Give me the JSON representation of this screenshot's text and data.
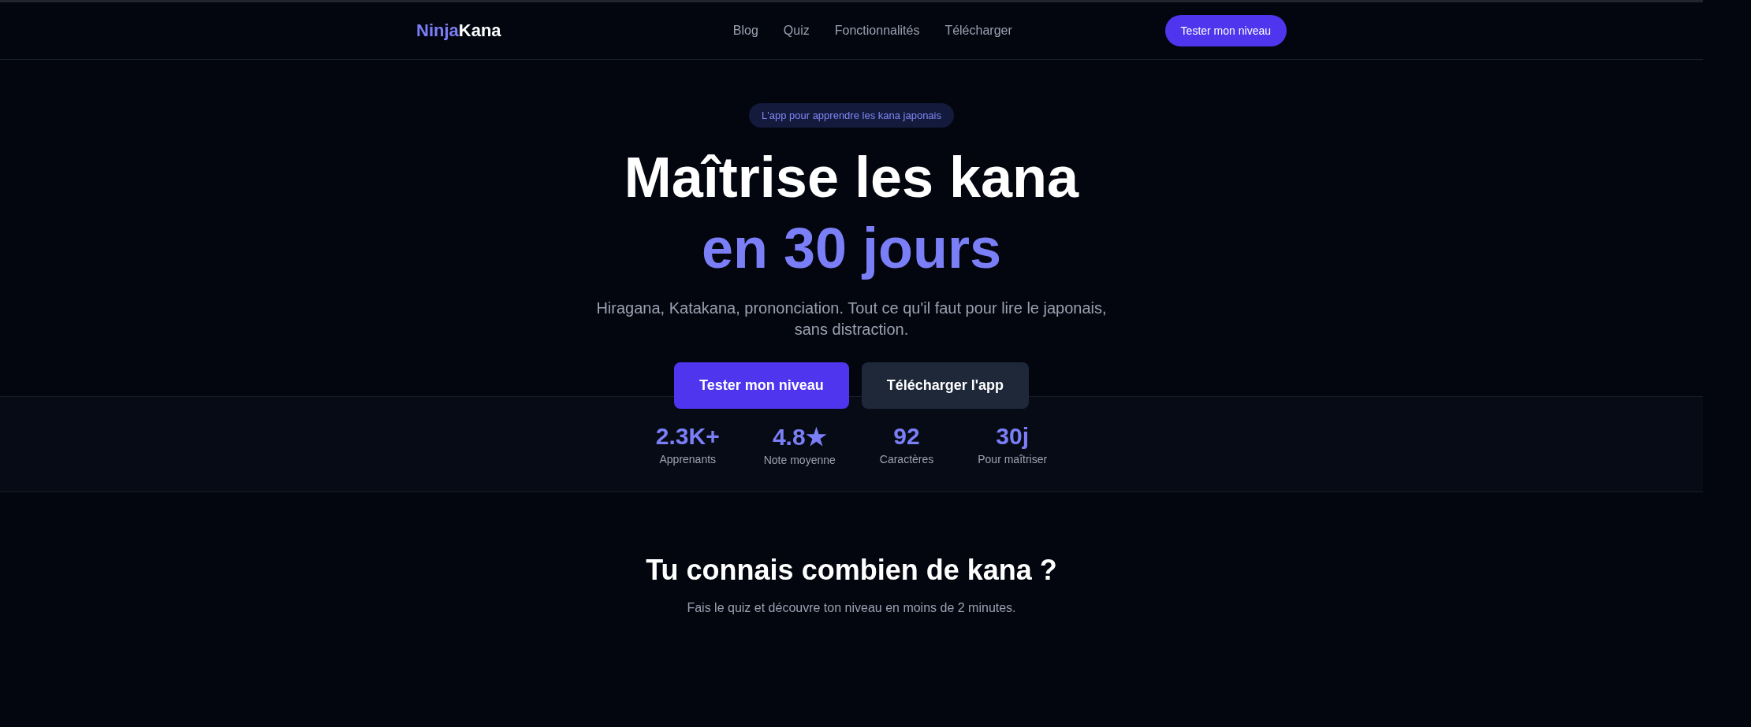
{
  "nav": {
    "logo": {
      "first": "Ninja",
      "second": "Kana"
    },
    "links": [
      "Blog",
      "Quiz",
      "Fonctionnalités",
      "Télécharger"
    ],
    "cta": "Tester mon niveau"
  },
  "hero": {
    "badge": "L'app pour apprendre les kana japonais",
    "title_line_1": "Maîtrise les kana",
    "title_line_2": "en 30 jours",
    "subtitle": "Hiragana, Katakana, prononciation. Tout ce qu'il faut pour lire le japonais, sans distraction.",
    "buttons": [
      {
        "label": "Tester mon niveau",
        "kind": "primary"
      },
      {
        "label": "Télécharger l'app",
        "kind": "secondary"
      }
    ]
  },
  "stats": [
    {
      "value": "2.3K+",
      "label": "Apprenants"
    },
    {
      "value": "4.8★",
      "label": "Note moyenne"
    },
    {
      "value": "92",
      "label": "Caractères"
    },
    {
      "value": "30j",
      "label": "Pour maîtriser"
    }
  ],
  "quiz_section": {
    "title": "Tu connais combien de kana ?",
    "subtitle": "Fais le quiz et découvre ton niveau en moins de 2 minutes."
  }
}
